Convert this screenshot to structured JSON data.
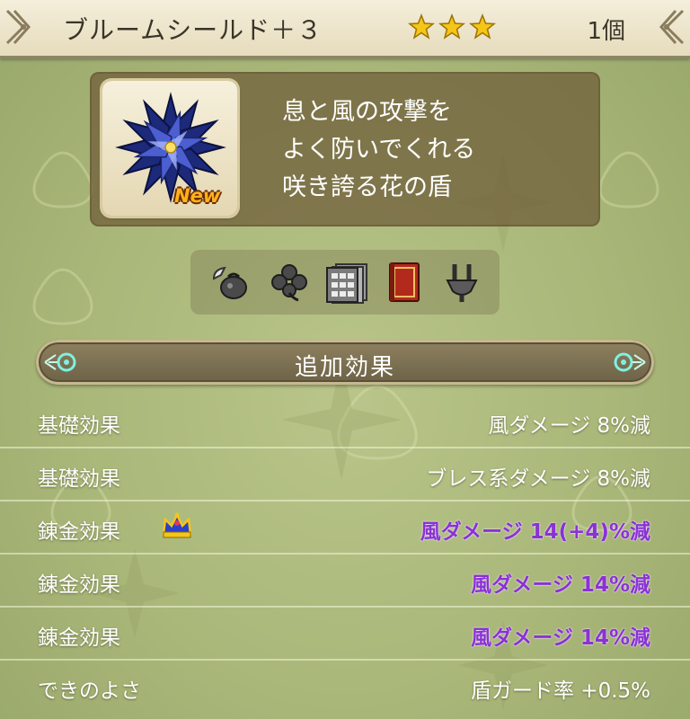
{
  "header": {
    "item_name": "ブルームシールド＋３",
    "star_count": 3,
    "count": "1個"
  },
  "item": {
    "icon": "bloom-shield-icon",
    "badge": "New",
    "description": [
      "息と風の攻撃を",
      "よく防いでくれる",
      "咲き誇る花の盾"
    ]
  },
  "tools": [
    {
      "icon": "item-bag-icon"
    },
    {
      "icon": "clover-icon"
    },
    {
      "icon": "card-stack-icon"
    },
    {
      "icon": "red-book-icon"
    },
    {
      "icon": "tuning-fork-icon"
    }
  ],
  "section": {
    "title": "追加効果"
  },
  "effects": [
    {
      "label": "基礎効果",
      "value": "風ダメージ  8%減",
      "type": "base"
    },
    {
      "label": "基礎効果",
      "value": "ブレス系ダメージ  8%減",
      "type": "base"
    },
    {
      "label": "錬金効果",
      "value": "風ダメージ  14(+4)%減",
      "type": "alchemy",
      "icon": "crown-icon"
    },
    {
      "label": "錬金効果",
      "value": "風ダメージ  14%減",
      "type": "alchemy"
    },
    {
      "label": "錬金効果",
      "value": "風ダメージ  14%減",
      "type": "alchemy"
    },
    {
      "label": "できのよさ",
      "value": "盾ガード率  +0.5%",
      "type": "base"
    }
  ],
  "colors": {
    "background": "#a9b779",
    "alchemy_text": "#8a32d4",
    "star": "#f5c518"
  }
}
